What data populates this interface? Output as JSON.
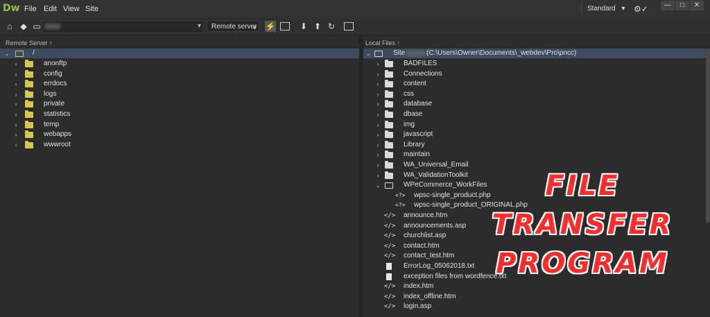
{
  "app": {
    "logo": "Dw"
  },
  "menus": [
    {
      "label": "File"
    },
    {
      "label": "Edit"
    },
    {
      "label": "View"
    },
    {
      "label": "Site"
    }
  ],
  "workspace": {
    "label": "Standard",
    "caret": "▾"
  },
  "window_buttons": [
    {
      "glyph": "—"
    },
    {
      "glyph": "□"
    },
    {
      "glyph": "✕"
    }
  ],
  "toolbar": {
    "remote_select": "Remote server",
    "icons": [
      "connect-icon",
      "git-icon",
      "folder-icon",
      "sync-icon",
      "expand-icon",
      "get-icon",
      "put-icon",
      "refresh-icon",
      "view-icon"
    ]
  },
  "remote": {
    "header": "Remote Server",
    "root": "/",
    "items": [
      "anonftp",
      "config",
      "errdocs",
      "logs",
      "private",
      "statistics",
      "temp",
      "webapps",
      "wwwroot"
    ]
  },
  "local": {
    "header": "Local Files",
    "root_prefix": "Site",
    "root_path": "(C:\\Users\\Owner\\Documents\\_webdev\\Pro\\pncc)",
    "folders": [
      "BADFILES",
      "Connections",
      "content",
      "css",
      "database",
      "dbase",
      "img",
      "javascript",
      "Library",
      "maintain",
      "WA_Universal_Email",
      "WA_ValidationToolkit"
    ],
    "open_folder": "WPeCommerce_WorkFiles",
    "sub_files": [
      "wpsc-single_product.php",
      "wpsc-single_product_ORIGINAL.php"
    ],
    "files": [
      {
        "name": "announce.htm",
        "type": "code"
      },
      {
        "name": "announcements.asp",
        "type": "code"
      },
      {
        "name": "churchlist.asp",
        "type": "code"
      },
      {
        "name": "contact.htm",
        "type": "code"
      },
      {
        "name": "contact_test.htm",
        "type": "code"
      },
      {
        "name": "ErrorLog_05062018.txt",
        "type": "doc"
      },
      {
        "name": "exception files from wordfence.txt",
        "type": "doc"
      },
      {
        "name": "index.htm",
        "type": "code"
      },
      {
        "name": "index_offline.htm",
        "type": "code"
      },
      {
        "name": "login.asp",
        "type": "code"
      }
    ]
  },
  "banner": {
    "lines": [
      "File",
      "Transfer",
      "Program"
    ]
  },
  "colors": {
    "accent": "#8bc34a",
    "folder": "#d7c650",
    "selection": "#3c4b5e",
    "banner": "#ff2a2a"
  }
}
